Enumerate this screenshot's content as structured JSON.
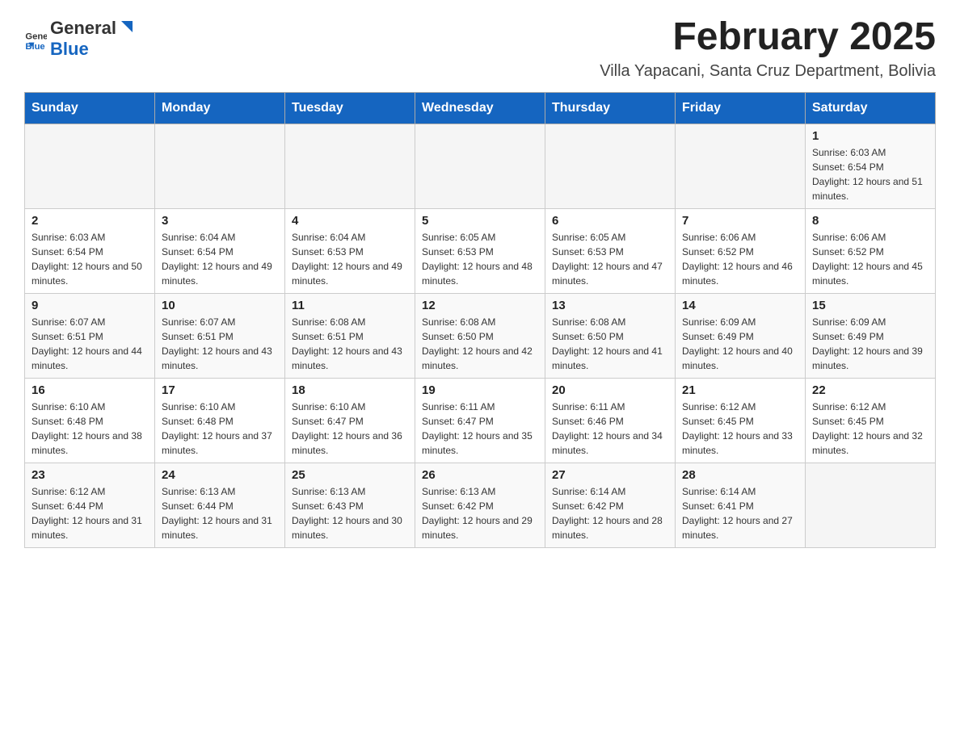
{
  "header": {
    "logo_general": "General",
    "logo_blue": "Blue",
    "month_title": "February 2025",
    "location": "Villa Yapacani, Santa Cruz Department, Bolivia"
  },
  "days_of_week": [
    "Sunday",
    "Monday",
    "Tuesday",
    "Wednesday",
    "Thursday",
    "Friday",
    "Saturday"
  ],
  "weeks": [
    [
      {
        "day": "",
        "sunrise": "",
        "sunset": "",
        "daylight": ""
      },
      {
        "day": "",
        "sunrise": "",
        "sunset": "",
        "daylight": ""
      },
      {
        "day": "",
        "sunrise": "",
        "sunset": "",
        "daylight": ""
      },
      {
        "day": "",
        "sunrise": "",
        "sunset": "",
        "daylight": ""
      },
      {
        "day": "",
        "sunrise": "",
        "sunset": "",
        "daylight": ""
      },
      {
        "day": "",
        "sunrise": "",
        "sunset": "",
        "daylight": ""
      },
      {
        "day": "1",
        "sunrise": "Sunrise: 6:03 AM",
        "sunset": "Sunset: 6:54 PM",
        "daylight": "Daylight: 12 hours and 51 minutes."
      }
    ],
    [
      {
        "day": "2",
        "sunrise": "Sunrise: 6:03 AM",
        "sunset": "Sunset: 6:54 PM",
        "daylight": "Daylight: 12 hours and 50 minutes."
      },
      {
        "day": "3",
        "sunrise": "Sunrise: 6:04 AM",
        "sunset": "Sunset: 6:54 PM",
        "daylight": "Daylight: 12 hours and 49 minutes."
      },
      {
        "day": "4",
        "sunrise": "Sunrise: 6:04 AM",
        "sunset": "Sunset: 6:53 PM",
        "daylight": "Daylight: 12 hours and 49 minutes."
      },
      {
        "day": "5",
        "sunrise": "Sunrise: 6:05 AM",
        "sunset": "Sunset: 6:53 PM",
        "daylight": "Daylight: 12 hours and 48 minutes."
      },
      {
        "day": "6",
        "sunrise": "Sunrise: 6:05 AM",
        "sunset": "Sunset: 6:53 PM",
        "daylight": "Daylight: 12 hours and 47 minutes."
      },
      {
        "day": "7",
        "sunrise": "Sunrise: 6:06 AM",
        "sunset": "Sunset: 6:52 PM",
        "daylight": "Daylight: 12 hours and 46 minutes."
      },
      {
        "day": "8",
        "sunrise": "Sunrise: 6:06 AM",
        "sunset": "Sunset: 6:52 PM",
        "daylight": "Daylight: 12 hours and 45 minutes."
      }
    ],
    [
      {
        "day": "9",
        "sunrise": "Sunrise: 6:07 AM",
        "sunset": "Sunset: 6:51 PM",
        "daylight": "Daylight: 12 hours and 44 minutes."
      },
      {
        "day": "10",
        "sunrise": "Sunrise: 6:07 AM",
        "sunset": "Sunset: 6:51 PM",
        "daylight": "Daylight: 12 hours and 43 minutes."
      },
      {
        "day": "11",
        "sunrise": "Sunrise: 6:08 AM",
        "sunset": "Sunset: 6:51 PM",
        "daylight": "Daylight: 12 hours and 43 minutes."
      },
      {
        "day": "12",
        "sunrise": "Sunrise: 6:08 AM",
        "sunset": "Sunset: 6:50 PM",
        "daylight": "Daylight: 12 hours and 42 minutes."
      },
      {
        "day": "13",
        "sunrise": "Sunrise: 6:08 AM",
        "sunset": "Sunset: 6:50 PM",
        "daylight": "Daylight: 12 hours and 41 minutes."
      },
      {
        "day": "14",
        "sunrise": "Sunrise: 6:09 AM",
        "sunset": "Sunset: 6:49 PM",
        "daylight": "Daylight: 12 hours and 40 minutes."
      },
      {
        "day": "15",
        "sunrise": "Sunrise: 6:09 AM",
        "sunset": "Sunset: 6:49 PM",
        "daylight": "Daylight: 12 hours and 39 minutes."
      }
    ],
    [
      {
        "day": "16",
        "sunrise": "Sunrise: 6:10 AM",
        "sunset": "Sunset: 6:48 PM",
        "daylight": "Daylight: 12 hours and 38 minutes."
      },
      {
        "day": "17",
        "sunrise": "Sunrise: 6:10 AM",
        "sunset": "Sunset: 6:48 PM",
        "daylight": "Daylight: 12 hours and 37 minutes."
      },
      {
        "day": "18",
        "sunrise": "Sunrise: 6:10 AM",
        "sunset": "Sunset: 6:47 PM",
        "daylight": "Daylight: 12 hours and 36 minutes."
      },
      {
        "day": "19",
        "sunrise": "Sunrise: 6:11 AM",
        "sunset": "Sunset: 6:47 PM",
        "daylight": "Daylight: 12 hours and 35 minutes."
      },
      {
        "day": "20",
        "sunrise": "Sunrise: 6:11 AM",
        "sunset": "Sunset: 6:46 PM",
        "daylight": "Daylight: 12 hours and 34 minutes."
      },
      {
        "day": "21",
        "sunrise": "Sunrise: 6:12 AM",
        "sunset": "Sunset: 6:45 PM",
        "daylight": "Daylight: 12 hours and 33 minutes."
      },
      {
        "day": "22",
        "sunrise": "Sunrise: 6:12 AM",
        "sunset": "Sunset: 6:45 PM",
        "daylight": "Daylight: 12 hours and 32 minutes."
      }
    ],
    [
      {
        "day": "23",
        "sunrise": "Sunrise: 6:12 AM",
        "sunset": "Sunset: 6:44 PM",
        "daylight": "Daylight: 12 hours and 31 minutes."
      },
      {
        "day": "24",
        "sunrise": "Sunrise: 6:13 AM",
        "sunset": "Sunset: 6:44 PM",
        "daylight": "Daylight: 12 hours and 31 minutes."
      },
      {
        "day": "25",
        "sunrise": "Sunrise: 6:13 AM",
        "sunset": "Sunset: 6:43 PM",
        "daylight": "Daylight: 12 hours and 30 minutes."
      },
      {
        "day": "26",
        "sunrise": "Sunrise: 6:13 AM",
        "sunset": "Sunset: 6:42 PM",
        "daylight": "Daylight: 12 hours and 29 minutes."
      },
      {
        "day": "27",
        "sunrise": "Sunrise: 6:14 AM",
        "sunset": "Sunset: 6:42 PM",
        "daylight": "Daylight: 12 hours and 28 minutes."
      },
      {
        "day": "28",
        "sunrise": "Sunrise: 6:14 AM",
        "sunset": "Sunset: 6:41 PM",
        "daylight": "Daylight: 12 hours and 27 minutes."
      },
      {
        "day": "",
        "sunrise": "",
        "sunset": "",
        "daylight": ""
      }
    ]
  ]
}
